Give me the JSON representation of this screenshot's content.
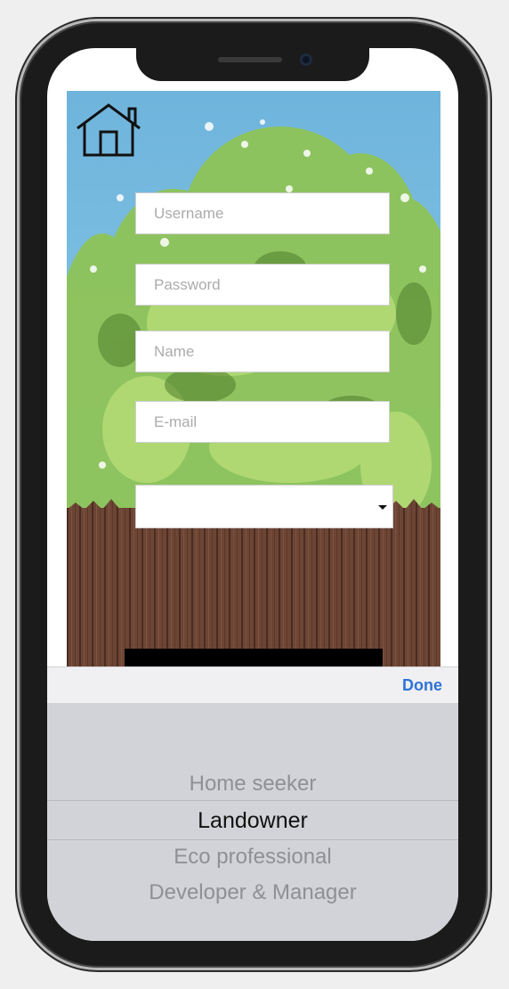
{
  "form": {
    "username_placeholder": "Username",
    "password_placeholder": "Password",
    "name_placeholder": "Name",
    "email_placeholder": "E-mail",
    "user_type_value": ""
  },
  "picker": {
    "done_label": "Done",
    "options": [
      "Home seeker",
      "Landowner",
      "Eco professional",
      "Developer & Manager"
    ],
    "selected_index": 1
  },
  "colors": {
    "sky": "#7dbfe2",
    "fence": "#6b4636",
    "accent": "#2f73d6",
    "picker_bg": "#d1d3d8"
  },
  "icons": {
    "home": "house-outline-icon",
    "select_caret": "caret-down-icon"
  }
}
